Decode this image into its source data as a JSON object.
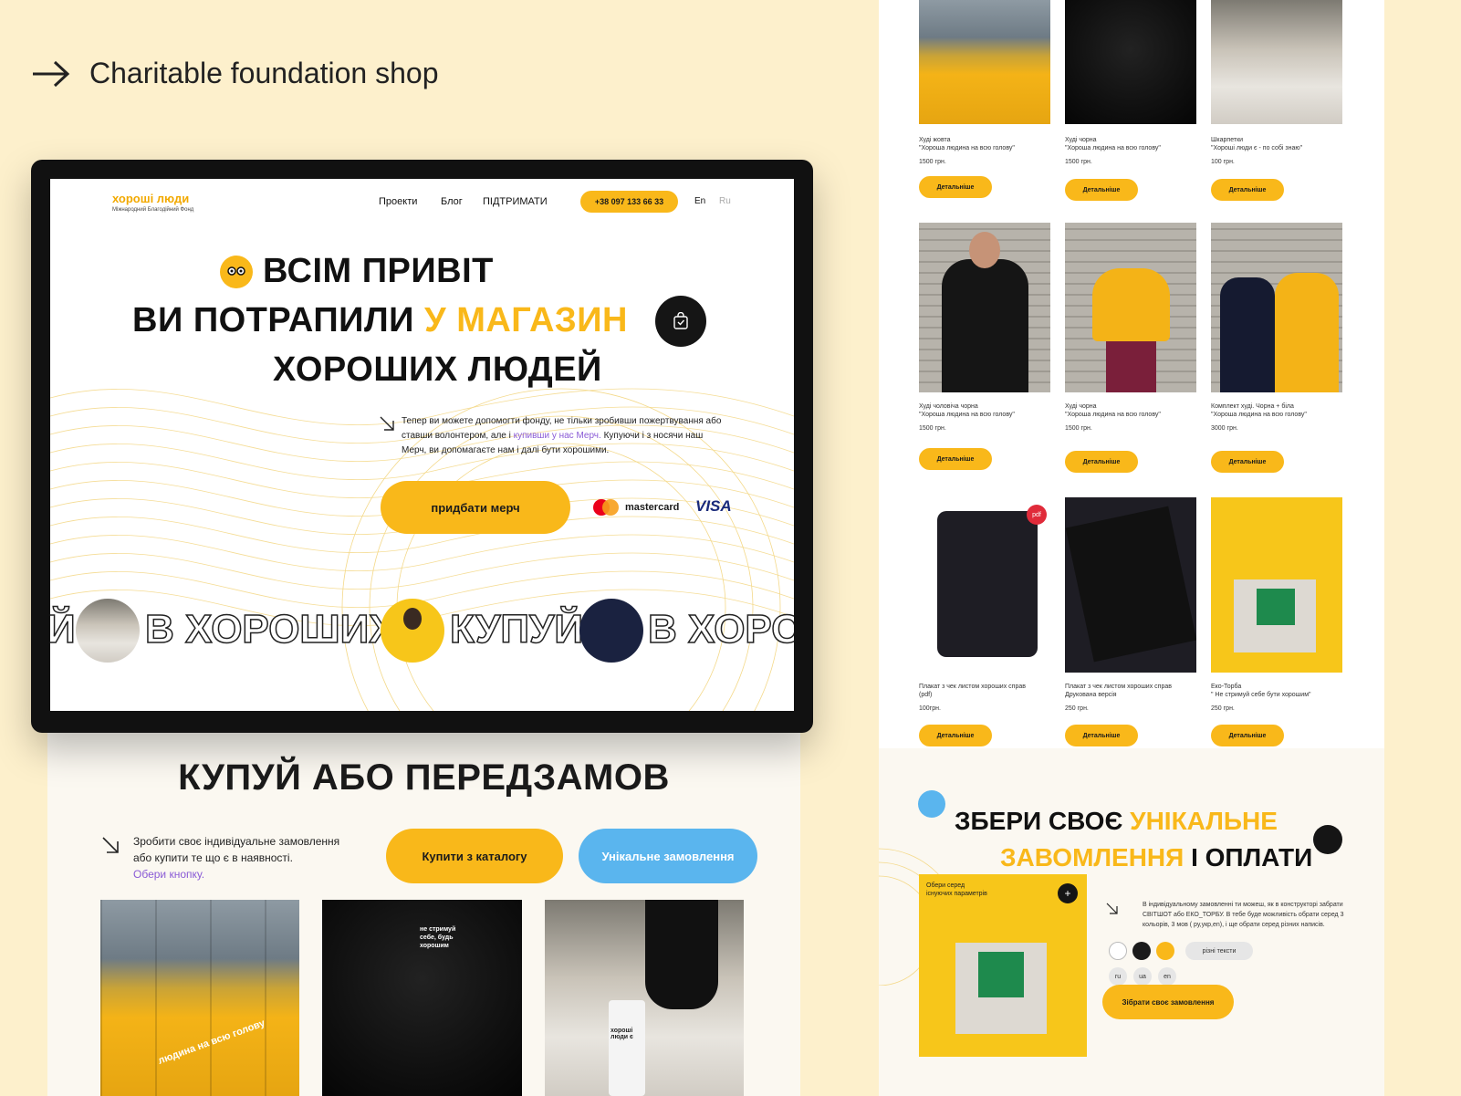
{
  "header": {
    "title": "Charitable foundation shop"
  },
  "colors": {
    "accent": "#f9b81a",
    "blue": "#5ab5ee",
    "background": "#fdf0cc",
    "link": "#8a5bd6"
  },
  "site": {
    "logo_main": "хороші люди",
    "logo_sub": "Міжнародний Благодійний Фонд",
    "nav": [
      "Проекти",
      "Блог",
      "ПІДТРИМАТИ"
    ],
    "phone": "+38 097 133 66 33",
    "lang_en": "En",
    "lang_ru": "Ru",
    "hero_line1": "ВСІМ ПРИВІТ",
    "hero_line2_a": "ВИ ПОТРАПИЛИ",
    "hero_line2_b": "У МАГАЗИН",
    "hero_line3": "ХОРОШИХ ЛЮДЕЙ",
    "desc_a": "Тепер ви можете допомогти фонду, не тільки зробивши пожертвування або ставши волонтером, але і ",
    "desc_link": "купивши у нас Мерч.",
    "desc_b": " Купуючи і з носячи наш Мерч, ви допомагаєте нам і далі бути хорошими.",
    "buy_button": "придбати  мерч",
    "mastercard": "mastercard",
    "visa": "VISA",
    "marquee": [
      "Й",
      "В ХОРОШИХ",
      "КУПУЙ",
      "В ХОРО"
    ]
  },
  "lower": {
    "title": "КУПУЙ АБО ПЕРЕДЗАМОВ",
    "desc": "Зробити своє індивідуальне замовлення або купити те що є в наявності.",
    "desc_link": "Обери кнопку.",
    "btn_catalog": "Купити з каталогу",
    "btn_unique": "Унікальне замовлення",
    "photo_text_1": "людина на всю голову",
    "photo_text_2": "не стримуй себе, будь хорошим",
    "photo_text_3": "хороші люди є"
  },
  "products": [
    {
      "name_1": "Худі жовта",
      "name_2": "\"Хороша людина на всю голову\"",
      "price": "1500 грн.",
      "button": "Детальніше"
    },
    {
      "name_1": "Худі чорна",
      "name_2": "\"Хороша людина на всю голову\"",
      "price": "1500 грн.",
      "button": "Детальніше"
    },
    {
      "name_1": "Шкарпетки",
      "name_2": "\"Хороші люди є - по собі знаю\"",
      "price": "100 грн.",
      "button": "Детальніше"
    },
    {
      "name_1": "Худі чоловіча чорна",
      "name_2": "\"Хороша людина на всю голову\"",
      "price": "1500 грн.",
      "button": "Детальніше"
    },
    {
      "name_1": "Худі чорна",
      "name_2": "\"Хороша людина на всю голову\"",
      "price": "1500 грн.",
      "button": "Детальніше"
    },
    {
      "name_1": "Комплект худі. Чорна + біла",
      "name_2": "\"Хороша людина на всю голову\"",
      "price": "3000 грн.",
      "button": "Детальніше"
    },
    {
      "name_1": "Плакат з чек листом хороших справ",
      "name_2": "(pdf)",
      "price": "100грн.",
      "button": "Детальніше"
    },
    {
      "name_1": "Плакат з чек листом хороших справ",
      "name_2": "Друкована версія",
      "price": "250 грн.",
      "button": "Детальніше"
    },
    {
      "name_1": "Еко-Торба",
      "name_2": "\" Не стримуй себе бути хорошим\"",
      "price": "250 грн.",
      "button": "Детальніше"
    }
  ],
  "builder": {
    "title_a": "ЗБЕРИ СВОЄ",
    "title_b": "УНІКАЛЬНЕ",
    "title_c": "ЗАВОМЛЕННЯ",
    "title_d": "І ОПЛАТИ",
    "image_caption": "Обери серед існуючих параметрів",
    "desc": "В індивідуальному замовленні ти можеш, як в конструкторі забрати СВІТШОТ або ЕКО_ТОРБУ. В тебе буде можливість обрати серед 3 кольорів, 3 мов ( ру,укр,en), і ще обрати серед різних написів.",
    "chip_texts": "різні тексти",
    "lang_ru": "ru",
    "lang_ua": "ua",
    "lang_en": "en",
    "collect_button": "Зібрати своє замовлення",
    "pdf_badge": "pdf"
  }
}
